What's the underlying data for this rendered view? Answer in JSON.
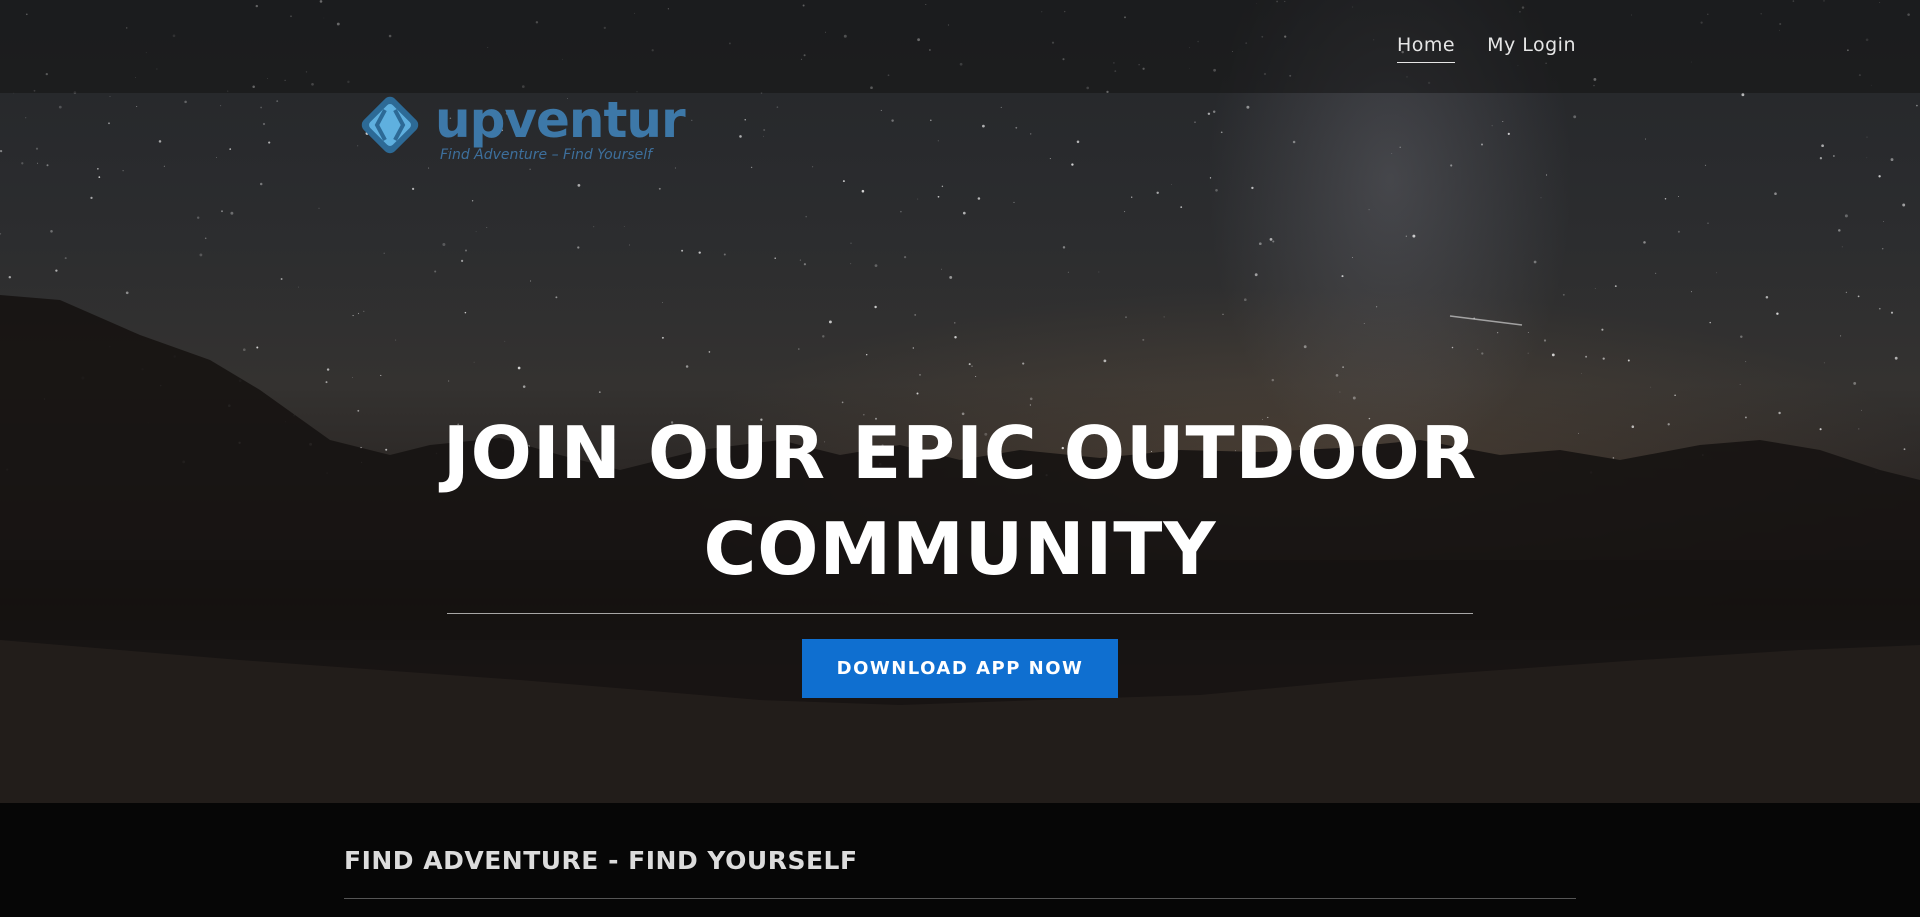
{
  "nav": {
    "items": [
      {
        "label": "Home",
        "active": true
      },
      {
        "label": "My Login",
        "active": false
      }
    ]
  },
  "logo": {
    "wordmark": "upventur",
    "tagline": "Find Adventure – Find Yourself"
  },
  "hero": {
    "title_line1": "JOIN OUR EPIC OUTDOOR",
    "title_line2": "COMMUNITY",
    "cta_label": "DOWNLOAD APP NOW"
  },
  "section": {
    "title": "FIND ADVENTURE - FIND YOURSELF"
  },
  "colors": {
    "cta": "#0f6fd0",
    "logo": "#3d78a8"
  }
}
